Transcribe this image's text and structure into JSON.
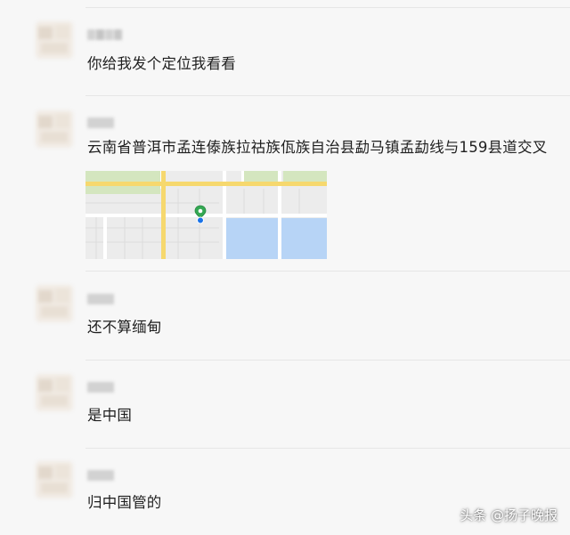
{
  "messages": [
    {
      "text": "你给我发个定位我看看"
    },
    {
      "text": "云南省普洱市孟连傣族拉祜族佤族自治县勐马镇孟勐线与159县道交叉"
    },
    {
      "text": "还不算缅甸"
    },
    {
      "text": "是中国"
    },
    {
      "text": "归中国管的"
    }
  ],
  "watermark": "头条 @扬子晚报",
  "colors": {
    "background": "#f7f7f7",
    "map_road_yellow": "#f6d86e",
    "map_park_green": "#cfe5b8",
    "map_water_blue": "#b5d3f7",
    "pin_green": "#34a853",
    "pin_dot_blue": "#1a73e8"
  },
  "icons": {
    "map_pin": "location-pin-icon"
  }
}
